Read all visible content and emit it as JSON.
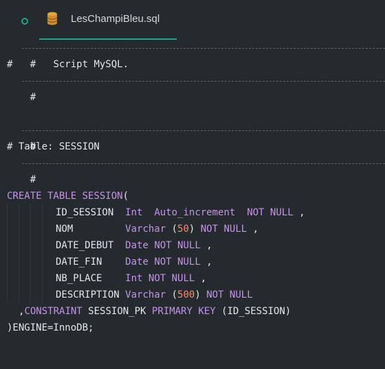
{
  "tab": {
    "filename": "LesChampiBleu.sql"
  },
  "code": {
    "hash": "#",
    "script_title": "Script MySQL.",
    "table_comment": "# Table: SESSION",
    "create_kw": "CREATE TABLE",
    "table_name": "SESSION",
    "open_paren": "(",
    "columns": [
      {
        "name": "ID_SESSION",
        "type": "Int",
        "extra": "Auto_increment",
        "constraint": "NOT NULL",
        "sep": ","
      },
      {
        "name": "NOM",
        "type": "Varchar",
        "len": "50",
        "constraint": "NOT NULL",
        "sep": ","
      },
      {
        "name": "DATE_DEBUT",
        "type": "Date",
        "constraint": "NOT NULL",
        "sep": ","
      },
      {
        "name": "DATE_FIN",
        "type": "Date",
        "constraint": "NOT NULL",
        "sep": ","
      },
      {
        "name": "NB_PLACE",
        "type": "Int",
        "constraint": "NOT NULL",
        "sep": ","
      },
      {
        "name": "DESCRIPTION",
        "type": "Varchar",
        "len": "500",
        "constraint": "NOT NULL"
      }
    ],
    "constraint_prefix": ",",
    "constraint_kw": "CONSTRAINT",
    "constraint_name": "SESSION_PK",
    "pk_kw": "PRIMARY KEY",
    "pk_cols": "(ID_SESSION)",
    "engine_line": ")ENGINE=InnoDB;"
  },
  "colors": {
    "background": "#252a2e",
    "accent": "#1fa58f",
    "keyword": "#c792ea",
    "number": "#f78c6c",
    "text": "#e6e6e6"
  },
  "icons": {
    "status": "circle-icon",
    "file": "database-icon"
  }
}
